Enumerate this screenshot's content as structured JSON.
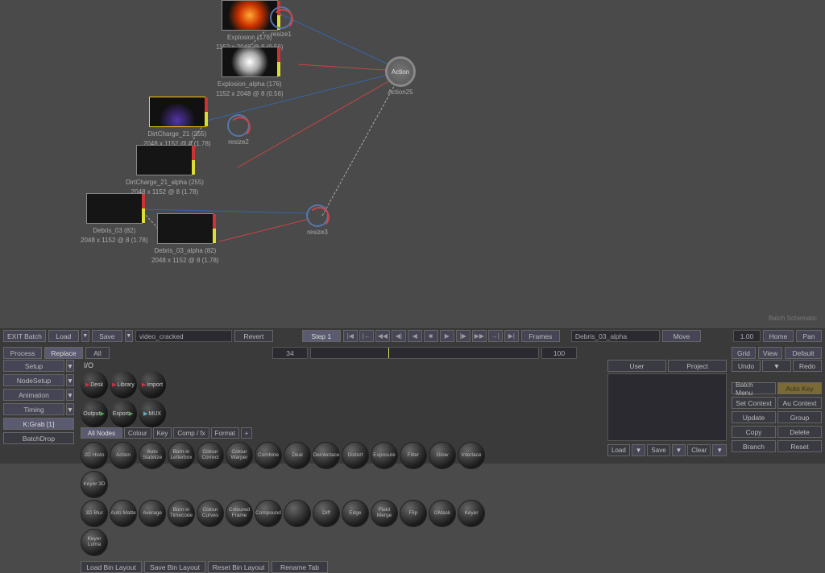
{
  "canvas": {
    "nodes": {
      "explosion": {
        "name": "Explosion (176)",
        "res": "1152 x 2048 @ 8 (0.56)"
      },
      "explosion_alpha": {
        "name": "Explosion_alpha (176)",
        "res": "1152 x 2048 @ 8 (0.56)"
      },
      "dirt": {
        "name": "DirtCharge_21 (255)",
        "res": "2048 x 1152 @ 8 (1.78)"
      },
      "dirt_alpha": {
        "name": "DirtCharge_21_alpha (255)",
        "res": "2048 x 1152 @ 8 (1.78)"
      },
      "debris": {
        "name": "Debris_03 (82)",
        "res": "2048 x 1152 @ 8 (1.78)"
      },
      "debris_alpha": {
        "name": "Debris_03_alpha (82)",
        "res": "2048 x 1152 @ 8 (1.78)"
      },
      "action": "Action",
      "action_sub": "Action25",
      "resize1": "resize1",
      "resize2": "resize2",
      "resize3": "resize3"
    },
    "status": "Batch Schematic"
  },
  "toolbar": {
    "exit": "EXIT Batch",
    "load": "Load",
    "save": "Save",
    "filename": "video_cracked",
    "revert": "Revert",
    "step": "Step 1",
    "frames": "Frames",
    "clip_name": "Debris_03_alpha",
    "move": "Move",
    "zoom": "1.00",
    "home": "Home",
    "pan": "Pan"
  },
  "row2": {
    "process": "Process",
    "replace": "Replace",
    "all": "All",
    "cur_frame": "34",
    "end_frame": "100",
    "grid": "Grid",
    "view": "View",
    "default": "Default"
  },
  "sidebar_left": {
    "setup": "Setup",
    "nodesetup": "NodeSetup",
    "animation": "Animation",
    "timing": "Timing",
    "kgrab": "K:Grab [1]",
    "batchdrop": "BatchDrop"
  },
  "sidebar_right": {
    "undo": "Undo",
    "redo": "Redo",
    "batch_menu": "Batch Menu",
    "auto_key": "Auto Key",
    "set_context": "Set Context",
    "au_context": "Au Context",
    "update": "Update",
    "group": "Group",
    "copy": "Copy",
    "delete": "Delete",
    "branch": "Branch",
    "reset": "Reset"
  },
  "io": {
    "header": "I/O",
    "desk": "Desk",
    "library": "Library",
    "import": "Import",
    "output": "Output",
    "export": "Export",
    "mux": "MUX"
  },
  "bin": {
    "tabs": {
      "all": "All Nodes",
      "colour": "Colour",
      "key": "Key",
      "comp": "Comp / fx",
      "format": "Format",
      "plus": "+"
    },
    "nodes_r1": [
      "2D Histo",
      "Action",
      "Auto Stabilize",
      "Burn-in Letterbox",
      "Colour Correct",
      "Colour Warper",
      "Combine",
      "Deal",
      "Deinterlace",
      "Distort",
      "Exposure",
      "Filter",
      "Glow",
      "Interlace",
      "Keyer 3D"
    ],
    "nodes_r2": [
      "3D Blur",
      "Auto Matte",
      "Average",
      "Burn-in Timecode",
      "Colour Curves",
      "Coloured Frame",
      "Compound",
      "",
      "Diff",
      "Edge",
      "Field Merge",
      "Flip",
      "GMask",
      "Keyer",
      "Keyer Luma"
    ],
    "footer": {
      "load": "Load Bin Layout",
      "save": "Save Bin Layout",
      "reset": "Reset Bin Layout",
      "rename": "Rename Tab"
    }
  },
  "user": {
    "user_tab": "User",
    "project_tab": "Project",
    "load": "Load",
    "save": "Save",
    "clear": "Clear"
  }
}
